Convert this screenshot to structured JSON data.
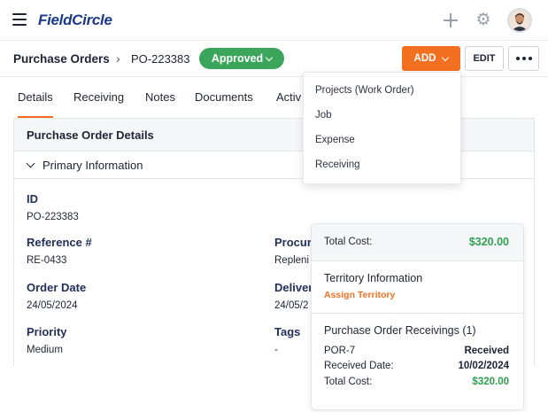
{
  "app": {
    "logo": "FieldCircle"
  },
  "breadcrumb": {
    "root": "Purchase Orders",
    "separator": "›",
    "current": "PO-223383"
  },
  "status": {
    "label": "Approved",
    "color": "#3ba55c"
  },
  "actions": {
    "add_label": "ADD",
    "edit_label": "EDIT"
  },
  "tabs": [
    "Details",
    "Receiving",
    "Notes",
    "Documents",
    "Activ"
  ],
  "card": {
    "title": "Purchase Order Details",
    "section": "Primary Information",
    "fields": {
      "id": {
        "label": "ID",
        "value": "PO-223383"
      },
      "reference": {
        "label": "Reference #",
        "value": "RE-0433"
      },
      "order_date": {
        "label": "Order Date",
        "value": "24/05/2024"
      },
      "priority": {
        "label": "Priority",
        "value": "Medium"
      },
      "procurement": {
        "label": "Procure",
        "value": "Repleni"
      },
      "delivery": {
        "label": "Deliver",
        "value": "24/05/2"
      },
      "tags": {
        "label": "Tags",
        "value": "-"
      }
    }
  },
  "add_menu": {
    "items": [
      "Projects (Work Order)",
      "Job",
      "Expense",
      "Receiving"
    ]
  },
  "summary": {
    "total_cost_label": "Total Cost:",
    "total_cost_value": "$320.00",
    "territory_title": "Territory Information",
    "territory_link": "Assign Territory",
    "receivings_title": "Purchase Order Receivings (1)",
    "receiving_id": "POR-7",
    "receiving_status": "Received",
    "received_date_label": "Received Date:",
    "received_date_value": "10/02/2024",
    "receiving_cost_label": "Total Cost:",
    "receiving_cost_value": "$320.00"
  },
  "colors": {
    "accent": "#f37021",
    "brand": "#1b3a8c",
    "success": "#2e9e4f"
  }
}
